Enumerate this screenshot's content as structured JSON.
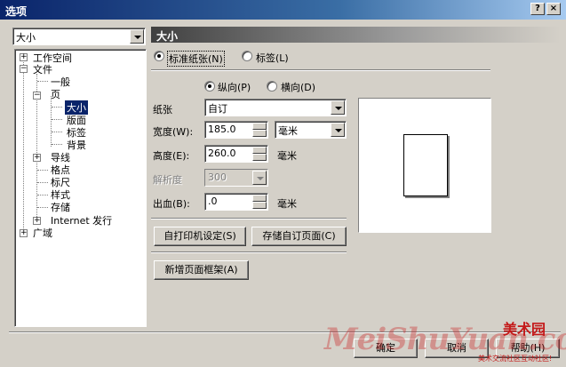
{
  "window": {
    "title": "选项",
    "help_btn": "?",
    "close_btn": "×"
  },
  "category_combo": {
    "value": "大小"
  },
  "tree": {
    "items": [
      {
        "label": "工作空间",
        "expander": "+"
      },
      {
        "label": "文件",
        "expander": "−"
      },
      {
        "label": "一般"
      },
      {
        "label": "页",
        "expander": "−"
      },
      {
        "label": "大小",
        "selected": true
      },
      {
        "label": "版面"
      },
      {
        "label": "标签"
      },
      {
        "label": "背景"
      },
      {
        "label": "导线",
        "expander": "+"
      },
      {
        "label": "格点"
      },
      {
        "label": "标尺"
      },
      {
        "label": "样式"
      },
      {
        "label": "存储"
      },
      {
        "label": "Internet 发行",
        "expander": "+"
      },
      {
        "label": "广域",
        "expander": "+"
      }
    ]
  },
  "panel": {
    "header": "大小",
    "radio_standard": "标准纸张(N)",
    "radio_label": "标签(L)",
    "radio_portrait": "纵向(P)",
    "radio_landscape": "横向(D)",
    "paper_label": "纸张",
    "paper_value": "自订",
    "width_label": "宽度(W):",
    "width_value": "185.0",
    "unit_value": "毫米",
    "height_label": "高度(E):",
    "height_value": "260.0",
    "height_unit": "毫米",
    "resolution_label": "解析度",
    "resolution_value": "300",
    "bleed_label": "出血(B):",
    "bleed_value": ".0",
    "bleed_unit": "毫米",
    "btn_printer": "自打印机设定(S)",
    "btn_save_page": "存储自订页面(C)",
    "btn_add_frame": "新增页面框架(A)"
  },
  "footer": {
    "ok": "确定",
    "cancel": "取消",
    "help": "帮助(H)"
  },
  "watermark": {
    "big": "MeiShuYuan.com",
    "logo": "美术园",
    "sub": "美术交流社区互动社区!"
  }
}
